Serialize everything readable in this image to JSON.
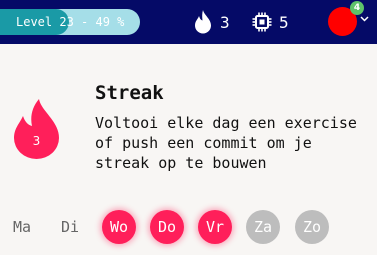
{
  "header": {
    "level_label": "Level 23 - 49 %",
    "level_progress": 0.49,
    "flame_count": "3",
    "chip_count": "5",
    "avatar_badge": "4",
    "colors": {
      "bar_bg": "#050a67",
      "level_fill": "#1a9aa6",
      "level_track": "#a5dee8",
      "avatar": "#ff0000",
      "badge": "#5ec26a"
    },
    "icons": [
      "flame-icon",
      "chip-icon",
      "chevron-down-icon"
    ]
  },
  "streak": {
    "count": "3",
    "title": "Streak",
    "description": "Voltooi elke dag een exercise of push een commit om je streak op te bouwen",
    "accent_color": "#ff1f5a"
  },
  "days": [
    {
      "label": "Ma",
      "state": "none"
    },
    {
      "label": "Di",
      "state": "none"
    },
    {
      "label": "Wo",
      "state": "done"
    },
    {
      "label": "Do",
      "state": "done"
    },
    {
      "label": "Vr",
      "state": "done"
    },
    {
      "label": "Za",
      "state": "future"
    },
    {
      "label": "Zo",
      "state": "future"
    }
  ]
}
